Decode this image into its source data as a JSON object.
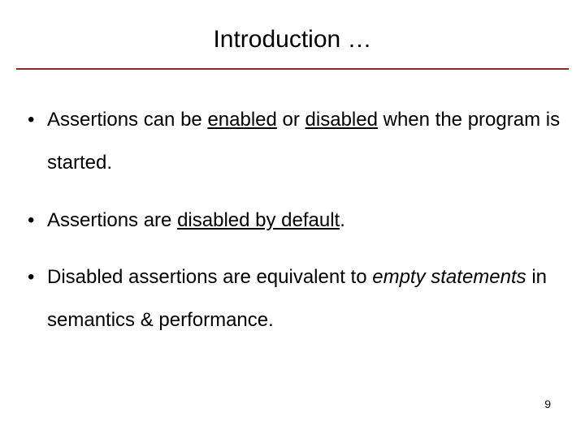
{
  "title": "Introduction …",
  "bullets": {
    "b0": {
      "pre": "Assertions can be ",
      "u1": "enabled",
      "mid1": " or ",
      "u2": "disabled",
      "post": " when the program is started."
    },
    "b1": {
      "pre": "Assertions are ",
      "u1": "disabled by default",
      "post": "."
    },
    "b2": {
      "pre": "Disabled assertions are equivalent to ",
      "it1": "empty statements",
      "post": " in semantics & performance."
    }
  },
  "page_number": "9"
}
